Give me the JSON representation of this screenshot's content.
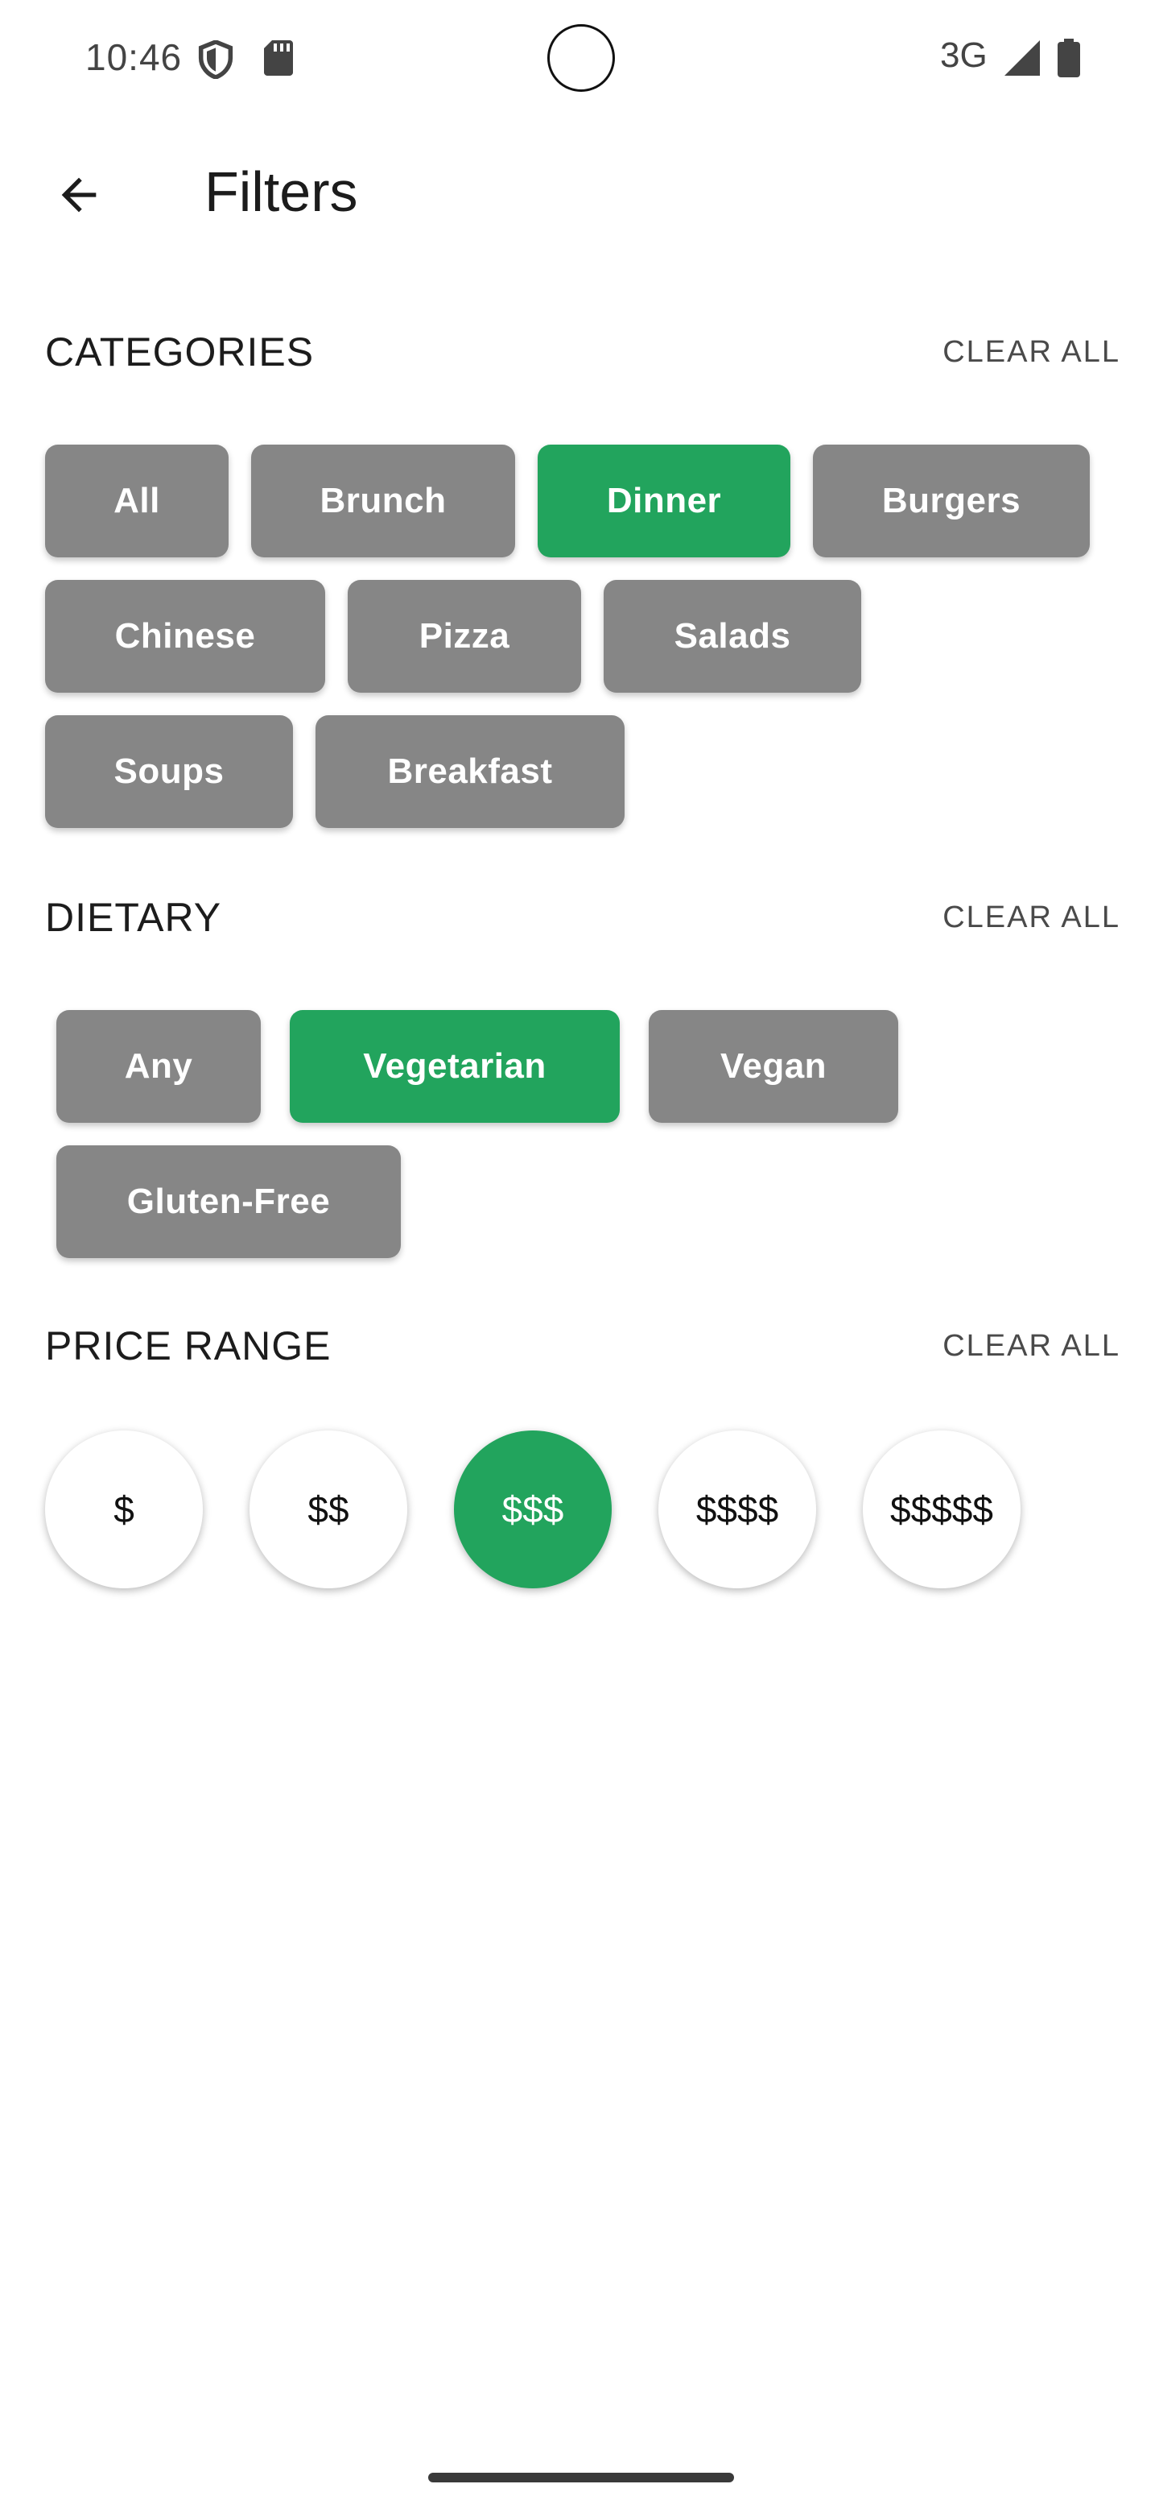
{
  "status_bar": {
    "time": "10:46",
    "network": "3G"
  },
  "app_bar": {
    "title": "Filters"
  },
  "categories": {
    "title": "CATEGORIES",
    "clear_label": "CLEAR ALL",
    "chips": [
      {
        "label": "All",
        "selected": false
      },
      {
        "label": "Brunch",
        "selected": false
      },
      {
        "label": "Dinner",
        "selected": true
      },
      {
        "label": "Burgers",
        "selected": false
      },
      {
        "label": "Chinese",
        "selected": false
      },
      {
        "label": "Pizza",
        "selected": false
      },
      {
        "label": "Salads",
        "selected": false
      },
      {
        "label": "Soups",
        "selected": false
      },
      {
        "label": "Breakfast",
        "selected": false
      }
    ]
  },
  "dietary": {
    "title": "DIETARY",
    "clear_label": "CLEAR ALL",
    "chips": [
      {
        "label": "Any",
        "selected": false
      },
      {
        "label": "Vegetarian",
        "selected": true
      },
      {
        "label": "Vegan",
        "selected": false
      },
      {
        "label": "Gluten-Free",
        "selected": false
      }
    ]
  },
  "price_range": {
    "title": "PRICE RANGE",
    "clear_label": "CLEAR ALL",
    "options": [
      {
        "label": "$",
        "selected": false
      },
      {
        "label": "$$",
        "selected": false
      },
      {
        "label": "$$$",
        "selected": true
      },
      {
        "label": "$$$$",
        "selected": false
      },
      {
        "label": "$$$$$",
        "selected": false
      }
    ]
  },
  "colors": {
    "selected": "#22a45d",
    "unselected_chip": "#868686",
    "text": "#1c1c1c"
  },
  "icons": {
    "back": "arrow-back-icon",
    "shield": "shield-icon",
    "sd_card": "sd-card-icon",
    "signal": "signal-icon",
    "battery": "battery-icon"
  }
}
